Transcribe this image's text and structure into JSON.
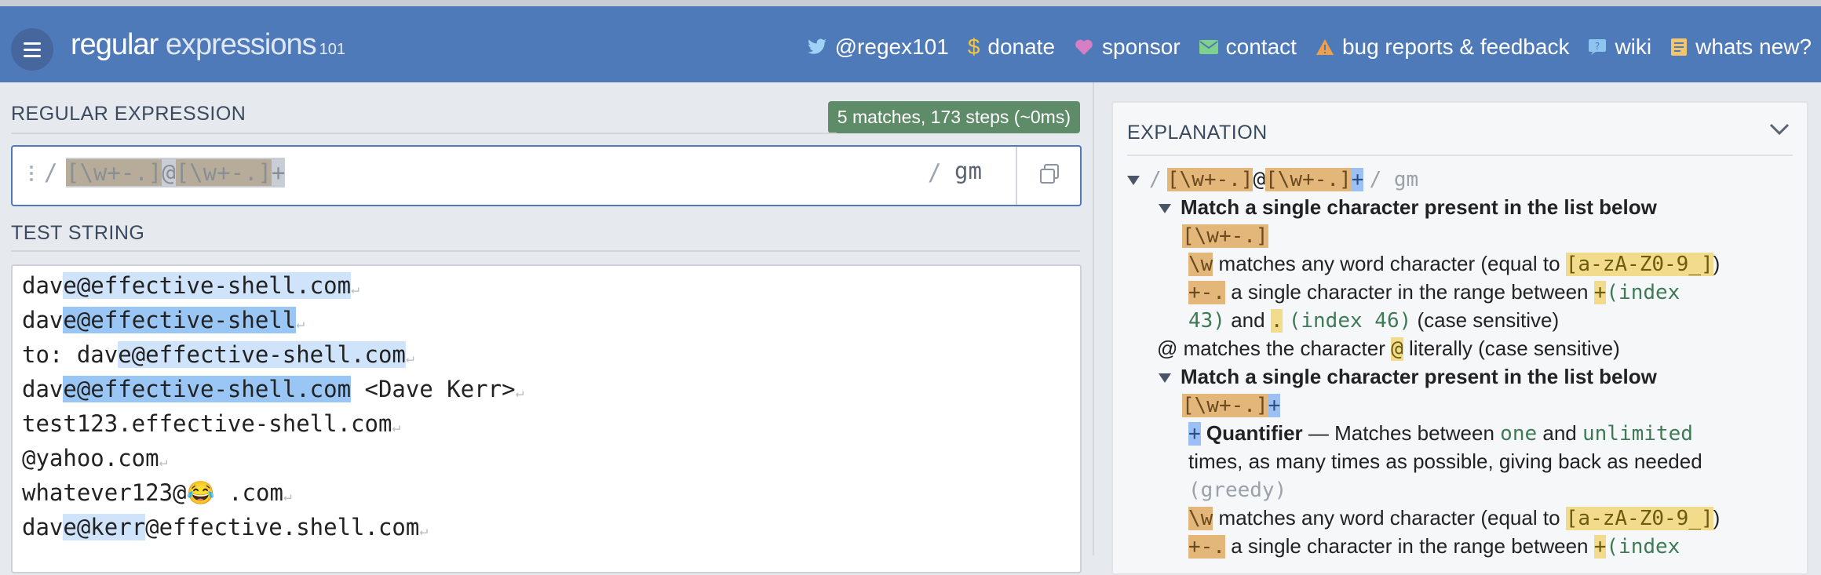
{
  "header": {
    "logo_main": "regular",
    "logo_thin": "expressions",
    "logo_version": "101",
    "nav": [
      {
        "icon": "twitter-icon",
        "label": "@regex101"
      },
      {
        "icon": "dollar-icon",
        "label": "donate"
      },
      {
        "icon": "heart-icon",
        "label": "sponsor"
      },
      {
        "icon": "mail-icon",
        "label": "contact"
      },
      {
        "icon": "warning-icon",
        "label": "bug reports & feedback"
      },
      {
        "icon": "wiki-icon",
        "label": "wiki"
      },
      {
        "icon": "news-icon",
        "label": "whats new?"
      }
    ]
  },
  "regex_section": {
    "title": "REGULAR EXPRESSION",
    "match_info": "5 matches, 173 steps (~0ms)",
    "open_delim": "/",
    "pattern_p1": "[\\w+-.]",
    "pattern_p2": "@",
    "pattern_p3": "[\\w+-.]",
    "pattern_p4": "+",
    "close_delim": "/",
    "flags": "gm"
  },
  "test_section": {
    "title": "TEST STRING",
    "lines": [
      {
        "a": "dav",
        "b": "e@effective-shell.com",
        "c": ""
      },
      {
        "a": "dav",
        "b": "e@effective-shell",
        "c": ""
      },
      {
        "a": "to: dav",
        "b": "e@effective-shell.com",
        "c": ""
      },
      {
        "a": "dav",
        "b": "e@effective-shell.com",
        "c": " <Dave Kerr>"
      },
      {
        "a": "test123.effective-shell.com",
        "b": "",
        "c": ""
      },
      {
        "a": "@yahoo.com",
        "b": "",
        "c": ""
      },
      {
        "a": "whatever123@😂 .com",
        "b": "",
        "c": ""
      },
      {
        "a": "dav",
        "b": "e@kerr",
        "c": "@effective.shell.com"
      }
    ]
  },
  "explanation": {
    "title": "EXPLANATION",
    "root_open": "/",
    "root_p1": "[\\w+-.]",
    "root_p2": "@",
    "root_p3": "[\\w+-.]",
    "root_p4": "+",
    "root_close": "/ gm",
    "match_heading": "Match a single character present in the list below",
    "cls": "[\\w+-.]",
    "w_tok": "\\w",
    "w_desc": "matches any word character (equal to",
    "w_eq": "[a-zA-Z0-9_]",
    "w_close": ")",
    "range_tok": "+-.",
    "range_desc": "a single character in the range between",
    "range_lo": "+",
    "range_lo_idx": "(index",
    "range_idx1": "43)",
    "range_and": "and",
    "range_hi": ".",
    "range_hi_idx": "(index 46)",
    "case_sens": "(case sensitive)",
    "at_line_a": "@ matches the character",
    "at_lit": "@",
    "at_line_b": "literally (case sensitive)",
    "cls2": "[\\w+-.]",
    "plus": "+",
    "quant_tok": "+",
    "quant_label": "Quantifier",
    "quant_dash": "— Matches between",
    "one": "one",
    "and": "and",
    "unlimited": "unlimited",
    "times_line": "times, as many times as possible, giving back as needed",
    "greedy": "(greedy)"
  }
}
